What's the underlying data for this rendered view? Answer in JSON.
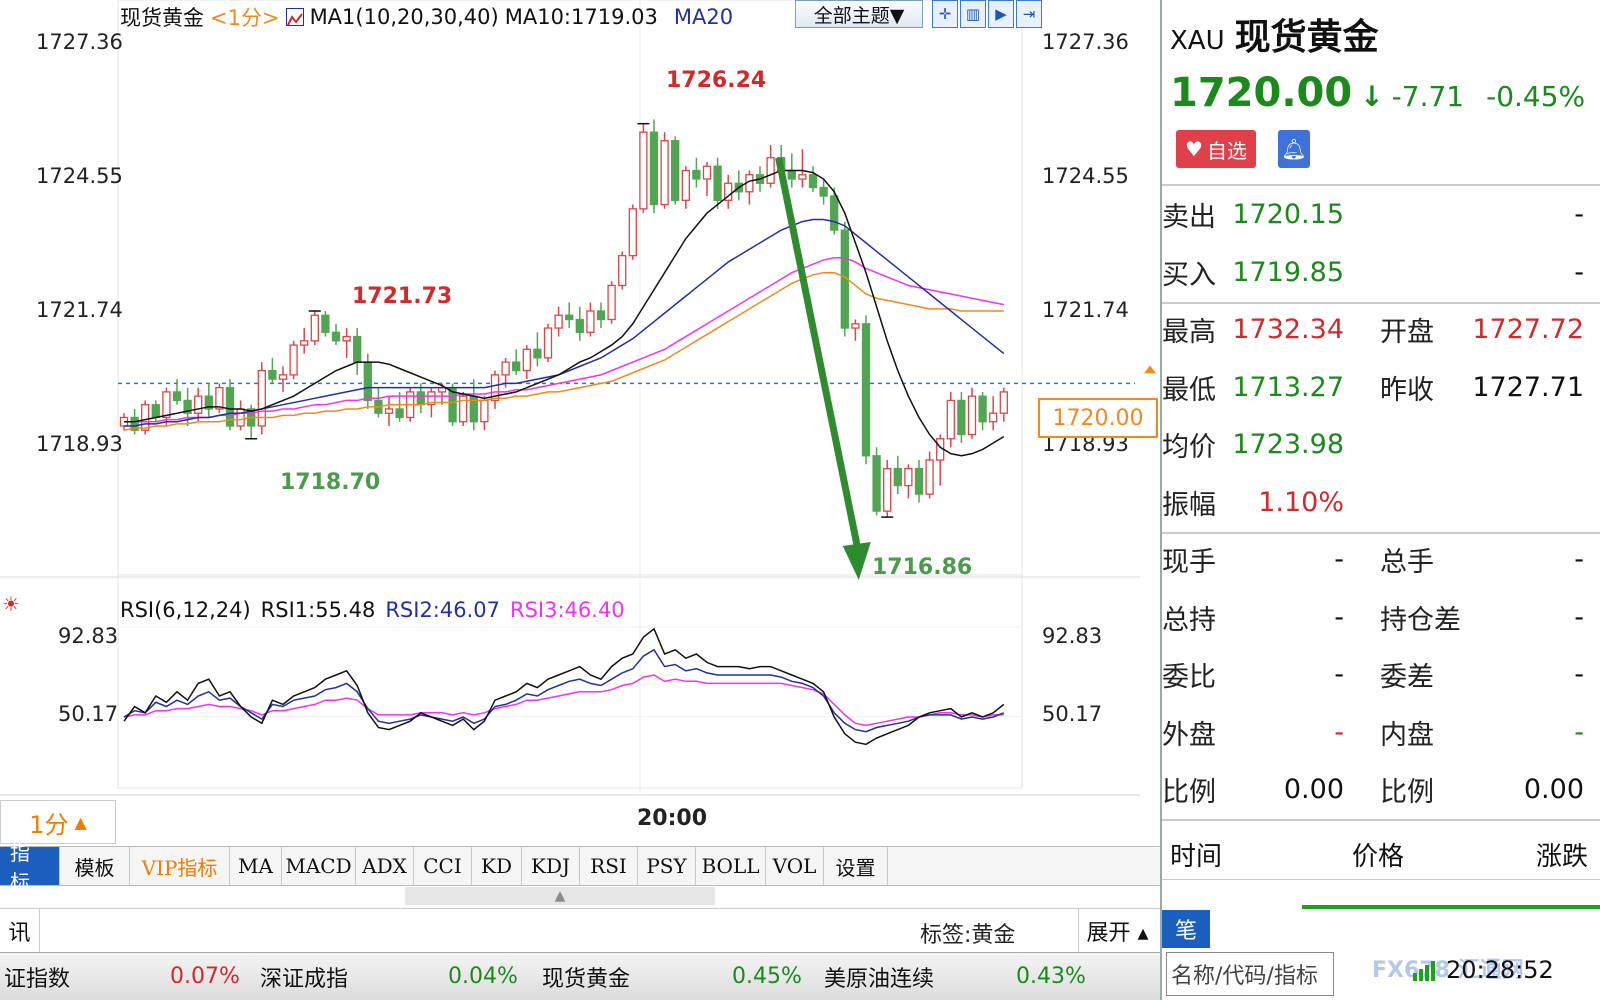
{
  "chart": {
    "symbol_label": "现货黄金",
    "period_tag": "<1分>",
    "ma_label": "MA1(10,20,30,40)",
    "ma10_label": "MA10:1719.03",
    "ma20_label": "MA20",
    "theme_button": "全部主题▼",
    "y_ticks": [
      "1727.36",
      "1724.55",
      "1721.74",
      "1718.93"
    ],
    "current_price_tag": "1720.00",
    "annotations": {
      "high1": "1726.24",
      "high2": "1721.73",
      "low1": "1718.70",
      "low2": "1716.86"
    },
    "rsi_legend": {
      "title": "RSI(6,12,24)",
      "rsi1": "RSI1:55.48",
      "rsi2": "RSI2:46.07",
      "rsi3": "RSI3:46.40"
    },
    "rsi_ticks": [
      "92.83",
      "50.17"
    ],
    "period_selector": "1分",
    "time_label": "20:00",
    "colors": {
      "up": "#d9464a",
      "down": "#52a552",
      "ma10": "#111111",
      "ma20": "#2230a0",
      "ma30": "#ee34ee",
      "ma40": "#f08a1c",
      "arrow": "#2e8b2e",
      "price_line": "#1f7ae0"
    }
  },
  "chart_data": {
    "type": "candlestick",
    "title": "现货黄金 <1分>",
    "ylim": [
      1715.5,
      1728.3
    ],
    "ohlc": [
      [
        1719.0,
        1719.3,
        1718.9,
        1719.2
      ],
      [
        1719.2,
        1719.4,
        1718.8,
        1718.9
      ],
      [
        1718.9,
        1719.6,
        1718.8,
        1719.5
      ],
      [
        1719.5,
        1719.6,
        1719.1,
        1719.2
      ],
      [
        1719.2,
        1719.9,
        1719.0,
        1719.8
      ],
      [
        1719.8,
        1720.1,
        1719.5,
        1719.6
      ],
      [
        1719.6,
        1719.9,
        1719.0,
        1719.3
      ],
      [
        1719.3,
        1719.9,
        1719.1,
        1719.7
      ],
      [
        1719.7,
        1720.0,
        1719.2,
        1719.4
      ],
      [
        1719.4,
        1720.0,
        1719.3,
        1719.9
      ],
      [
        1719.9,
        1720.1,
        1718.9,
        1719.0
      ],
      [
        1719.0,
        1719.6,
        1718.9,
        1719.4
      ],
      [
        1719.4,
        1719.5,
        1718.7,
        1719.0
      ],
      [
        1719.0,
        1720.5,
        1718.8,
        1720.3
      ],
      [
        1720.3,
        1720.6,
        1720.0,
        1720.1
      ],
      [
        1720.1,
        1720.4,
        1719.8,
        1720.2
      ],
      [
        1720.2,
        1721.0,
        1720.1,
        1720.9
      ],
      [
        1720.9,
        1721.3,
        1720.7,
        1721.0
      ],
      [
        1721.0,
        1721.7,
        1720.9,
        1721.6
      ],
      [
        1721.6,
        1721.7,
        1721.1,
        1721.2
      ],
      [
        1721.2,
        1721.4,
        1720.9,
        1721.0
      ],
      [
        1721.0,
        1721.3,
        1720.6,
        1721.1
      ],
      [
        1721.1,
        1721.3,
        1720.2,
        1720.5
      ],
      [
        1720.5,
        1720.7,
        1719.4,
        1719.6
      ],
      [
        1719.6,
        1719.9,
        1719.2,
        1719.3
      ],
      [
        1719.3,
        1719.7,
        1719.0,
        1719.4
      ],
      [
        1719.4,
        1719.8,
        1719.1,
        1719.2
      ],
      [
        1719.2,
        1719.9,
        1719.1,
        1719.8
      ],
      [
        1719.8,
        1720.0,
        1719.3,
        1719.5
      ],
      [
        1719.5,
        1719.9,
        1719.2,
        1719.8
      ],
      [
        1719.8,
        1720.0,
        1719.5,
        1719.9
      ],
      [
        1719.9,
        1720.0,
        1719.0,
        1719.1
      ],
      [
        1719.1,
        1719.8,
        1719.0,
        1719.7
      ],
      [
        1719.7,
        1720.1,
        1718.9,
        1719.1
      ],
      [
        1719.1,
        1719.7,
        1718.9,
        1719.6
      ],
      [
        1719.6,
        1720.3,
        1719.4,
        1720.2
      ],
      [
        1720.2,
        1720.6,
        1719.9,
        1720.5
      ],
      [
        1720.5,
        1720.8,
        1720.2,
        1720.3
      ],
      [
        1720.3,
        1720.9,
        1720.1,
        1720.8
      ],
      [
        1720.8,
        1721.2,
        1720.4,
        1720.6
      ],
      [
        1720.6,
        1721.4,
        1720.5,
        1721.3
      ],
      [
        1721.3,
        1721.8,
        1721.1,
        1721.6
      ],
      [
        1721.6,
        1721.9,
        1721.3,
        1721.5
      ],
      [
        1721.5,
        1721.8,
        1721.0,
        1721.2
      ],
      [
        1721.2,
        1721.9,
        1721.1,
        1721.7
      ],
      [
        1721.7,
        1721.9,
        1721.3,
        1721.5
      ],
      [
        1721.5,
        1722.4,
        1721.4,
        1722.3
      ],
      [
        1722.3,
        1723.1,
        1722.2,
        1723.0
      ],
      [
        1723.0,
        1724.2,
        1722.9,
        1724.1
      ],
      [
        1724.1,
        1726.1,
        1724.0,
        1725.9
      ],
      [
        1725.9,
        1726.2,
        1724.0,
        1724.2
      ],
      [
        1724.2,
        1725.9,
        1724.1,
        1725.7
      ],
      [
        1725.7,
        1725.8,
        1724.2,
        1724.3
      ],
      [
        1724.3,
        1725.1,
        1724.1,
        1725.0
      ],
      [
        1725.0,
        1725.3,
        1724.6,
        1724.8
      ],
      [
        1724.8,
        1725.2,
        1724.4,
        1725.1
      ],
      [
        1725.1,
        1725.3,
        1724.1,
        1724.3
      ],
      [
        1724.3,
        1724.9,
        1724.1,
        1724.7
      ],
      [
        1724.7,
        1725.0,
        1724.3,
        1724.5
      ],
      [
        1724.5,
        1725.0,
        1724.2,
        1724.9
      ],
      [
        1724.9,
        1725.1,
        1724.5,
        1724.7
      ],
      [
        1724.7,
        1725.6,
        1724.6,
        1725.3
      ],
      [
        1725.3,
        1725.6,
        1724.7,
        1725.0
      ],
      [
        1725.0,
        1725.4,
        1724.6,
        1724.8
      ],
      [
        1724.8,
        1725.5,
        1724.6,
        1724.9
      ],
      [
        1724.9,
        1725.1,
        1724.5,
        1724.6
      ],
      [
        1724.6,
        1724.8,
        1724.2,
        1724.4
      ],
      [
        1724.4,
        1724.6,
        1723.5,
        1723.6
      ],
      [
        1723.6,
        1723.8,
        1721.1,
        1721.3
      ],
      [
        1721.3,
        1721.5,
        1721.0,
        1721.4
      ],
      [
        1721.4,
        1721.6,
        1718.1,
        1718.3
      ],
      [
        1718.3,
        1718.5,
        1716.9,
        1717.0
      ],
      [
        1717.0,
        1718.2,
        1716.86,
        1718.0
      ],
      [
        1718.0,
        1718.3,
        1717.4,
        1717.6
      ],
      [
        1717.6,
        1718.1,
        1717.3,
        1718.0
      ],
      [
        1718.0,
        1718.2,
        1717.2,
        1717.4
      ],
      [
        1717.4,
        1718.4,
        1717.3,
        1718.2
      ],
      [
        1718.2,
        1718.8,
        1717.6,
        1718.7
      ],
      [
        1718.7,
        1719.8,
        1718.5,
        1719.6
      ],
      [
        1719.6,
        1719.8,
        1718.6,
        1718.8
      ],
      [
        1718.8,
        1719.9,
        1718.7,
        1719.7
      ],
      [
        1719.7,
        1719.8,
        1718.9,
        1719.1
      ],
      [
        1719.1,
        1719.7,
        1718.9,
        1719.3
      ],
      [
        1719.3,
        1719.9,
        1719.1,
        1719.8
      ]
    ],
    "ma10": [
      1719.1,
      1719.1,
      1719.15,
      1719.2,
      1719.25,
      1719.3,
      1719.35,
      1719.4,
      1719.45,
      1719.45,
      1719.4,
      1719.4,
      1719.35,
      1719.4,
      1719.5,
      1719.6,
      1719.7,
      1719.85,
      1720.0,
      1720.15,
      1720.3,
      1720.4,
      1720.5,
      1720.5,
      1720.5,
      1720.45,
      1720.35,
      1720.25,
      1720.15,
      1720.05,
      1719.95,
      1719.8,
      1719.75,
      1719.7,
      1719.65,
      1719.7,
      1719.75,
      1719.8,
      1719.9,
      1720.0,
      1720.1,
      1720.2,
      1720.35,
      1720.5,
      1720.6,
      1720.75,
      1720.9,
      1721.1,
      1721.4,
      1721.8,
      1722.2,
      1722.6,
      1723.0,
      1723.4,
      1723.7,
      1724.0,
      1724.2,
      1724.4,
      1724.6,
      1724.75,
      1724.8,
      1724.9,
      1725.0,
      1725.0,
      1725.0,
      1724.95,
      1724.8,
      1724.5,
      1724.0,
      1723.3,
      1722.6,
      1721.8,
      1721.0,
      1720.3,
      1719.7,
      1719.2,
      1718.8,
      1718.5,
      1718.35,
      1718.3,
      1718.35,
      1718.45,
      1718.6,
      1718.75
    ],
    "ma20": [
      1719.0,
      1719.0,
      1719.05,
      1719.05,
      1719.1,
      1719.1,
      1719.15,
      1719.2,
      1719.2,
      1719.25,
      1719.3,
      1719.3,
      1719.35,
      1719.4,
      1719.45,
      1719.5,
      1719.55,
      1719.6,
      1719.65,
      1719.7,
      1719.75,
      1719.8,
      1719.85,
      1719.9,
      1719.9,
      1719.9,
      1719.9,
      1719.9,
      1719.9,
      1719.9,
      1719.9,
      1719.9,
      1719.9,
      1719.9,
      1719.9,
      1719.95,
      1720.0,
      1720.0,
      1720.05,
      1720.1,
      1720.15,
      1720.2,
      1720.3,
      1720.4,
      1720.5,
      1720.6,
      1720.75,
      1720.9,
      1721.05,
      1721.25,
      1721.45,
      1721.65,
      1721.85,
      1722.05,
      1722.25,
      1722.45,
      1722.65,
      1722.85,
      1723.0,
      1723.15,
      1723.3,
      1723.45,
      1723.6,
      1723.7,
      1723.8,
      1723.85,
      1723.85,
      1723.8,
      1723.7,
      1723.5,
      1723.3,
      1723.1,
      1722.9,
      1722.7,
      1722.5,
      1722.3,
      1722.1,
      1721.9,
      1721.7,
      1721.5,
      1721.3,
      1721.1,
      1720.9,
      1720.7
    ],
    "ma30": [
      1719.1,
      1719.1,
      1719.1,
      1719.1,
      1719.15,
      1719.15,
      1719.2,
      1719.2,
      1719.2,
      1719.25,
      1719.25,
      1719.3,
      1719.3,
      1719.35,
      1719.35,
      1719.4,
      1719.4,
      1719.45,
      1719.5,
      1719.5,
      1719.55,
      1719.6,
      1719.6,
      1719.65,
      1719.65,
      1719.7,
      1719.7,
      1719.7,
      1719.7,
      1719.7,
      1719.7,
      1719.7,
      1719.75,
      1719.75,
      1719.75,
      1719.8,
      1719.8,
      1719.85,
      1719.85,
      1719.9,
      1719.95,
      1720.0,
      1720.05,
      1720.1,
      1720.15,
      1720.2,
      1720.3,
      1720.4,
      1720.5,
      1720.6,
      1720.7,
      1720.8,
      1720.95,
      1721.1,
      1721.25,
      1721.4,
      1721.55,
      1721.7,
      1721.85,
      1722.0,
      1722.15,
      1722.3,
      1722.45,
      1722.6,
      1722.7,
      1722.8,
      1722.9,
      1722.95,
      1722.95,
      1722.85,
      1722.7,
      1722.6,
      1722.5,
      1722.4,
      1722.3,
      1722.25,
      1722.2,
      1722.15,
      1722.1,
      1722.05,
      1722.0,
      1721.95,
      1721.9,
      1721.85
    ],
    "ma40": [
      1718.9,
      1718.95,
      1718.95,
      1719.0,
      1719.0,
      1719.05,
      1719.05,
      1719.1,
      1719.1,
      1719.1,
      1719.15,
      1719.15,
      1719.2,
      1719.2,
      1719.2,
      1719.25,
      1719.25,
      1719.3,
      1719.3,
      1719.35,
      1719.35,
      1719.4,
      1719.4,
      1719.45,
      1719.45,
      1719.5,
      1719.5,
      1719.5,
      1719.5,
      1719.55,
      1719.55,
      1719.55,
      1719.6,
      1719.6,
      1719.6,
      1719.65,
      1719.65,
      1719.7,
      1719.7,
      1719.75,
      1719.8,
      1719.8,
      1719.85,
      1719.9,
      1719.95,
      1720.0,
      1720.05,
      1720.15,
      1720.25,
      1720.35,
      1720.45,
      1720.55,
      1720.7,
      1720.85,
      1721.0,
      1721.15,
      1721.3,
      1721.45,
      1721.6,
      1721.75,
      1721.9,
      1722.05,
      1722.2,
      1722.35,
      1722.45,
      1722.55,
      1722.6,
      1722.6,
      1722.5,
      1722.3,
      1722.1,
      1722.0,
      1721.95,
      1721.9,
      1721.85,
      1721.8,
      1721.75,
      1721.75,
      1721.75,
      1721.7,
      1721.7,
      1721.7,
      1721.7,
      1721.7
    ],
    "rsi_ylim": [
      20,
      100
    ],
    "rsi1": [
      48,
      55,
      52,
      60,
      57,
      62,
      58,
      66,
      68,
      60,
      62,
      55,
      50,
      47,
      58,
      56,
      60,
      62,
      64,
      68,
      70,
      72,
      65,
      52,
      45,
      44,
      46,
      48,
      52,
      50,
      48,
      46,
      49,
      44,
      48,
      58,
      60,
      62,
      66,
      64,
      68,
      70,
      72,
      74,
      70,
      68,
      74,
      78,
      80,
      88,
      92,
      80,
      82,
      78,
      80,
      76,
      74,
      74,
      74,
      73,
      74,
      74,
      72,
      70,
      68,
      66,
      62,
      50,
      42,
      38,
      37,
      40,
      42,
      44,
      46,
      50,
      52,
      53,
      54,
      50,
      52,
      50,
      52,
      56
    ],
    "rsi2": [
      50,
      53,
      52,
      57,
      55,
      58,
      56,
      60,
      62,
      58,
      59,
      55,
      52,
      49,
      56,
      55,
      58,
      59,
      60,
      63,
      64,
      66,
      62,
      54,
      48,
      47,
      48,
      49,
      51,
      50,
      49,
      48,
      50,
      47,
      49,
      55,
      56,
      58,
      61,
      60,
      63,
      65,
      67,
      68,
      66,
      65,
      68,
      71,
      73,
      79,
      82,
      74,
      75,
      72,
      73,
      71,
      70,
      70,
      70,
      70,
      70,
      70,
      69,
      67,
      66,
      64,
      60,
      52,
      47,
      44,
      43,
      45,
      46,
      47,
      48,
      50,
      51,
      51,
      51,
      49,
      50,
      49,
      50,
      52
    ],
    "rsi3": [
      50,
      51,
      51,
      53,
      53,
      54,
      54,
      55,
      56,
      55,
      55,
      54,
      53,
      51,
      53,
      53,
      54,
      55,
      56,
      58,
      58,
      59,
      58,
      54,
      51,
      51,
      51,
      51,
      52,
      52,
      52,
      51,
      52,
      51,
      52,
      54,
      55,
      56,
      58,
      58,
      59,
      60,
      61,
      62,
      62,
      62,
      63,
      65,
      66,
      69,
      70,
      67,
      68,
      67,
      67,
      66,
      66,
      66,
      66,
      66,
      66,
      66,
      66,
      65,
      64,
      63,
      61,
      56,
      51,
      47,
      46,
      47,
      48,
      49,
      50,
      50,
      51,
      52,
      52,
      51,
      51,
      50,
      51,
      51
    ]
  },
  "tabs": [
    "指标",
    "模板",
    "VIP指标",
    "MA",
    "MACD",
    "ADX",
    "CCI",
    "KD",
    "KDJ",
    "RSI",
    "PSY",
    "BOLL",
    "VOL",
    "设置"
  ],
  "news": {
    "tab_label": "讯",
    "tag_text": "标签:黄金",
    "expand_label": "展开 ▴"
  },
  "ticker": [
    {
      "name": "证指数",
      "pct": "0.07%",
      "color": "#d12a2a"
    },
    {
      "name": "深证成指",
      "pct": "0.04%",
      "color": "#1a8a1a"
    },
    {
      "name": "现货黄金",
      "pct": "0.45%",
      "color": "#1a8a1a"
    },
    {
      "name": "美原油连续",
      "pct": "0.43%",
      "color": "#1a8a1a"
    }
  ],
  "quote": {
    "code": "XAU",
    "name": "现货黄金",
    "price": "1720.00",
    "arrow": "↓",
    "change": "-7.71",
    "change_pct": "-0.45%",
    "watch_label": "自选",
    "rows": [
      {
        "l1": "卖出",
        "v1": "1720.15",
        "c1": "green",
        "l2": "",
        "v2": "-",
        "c2": "blk"
      },
      {
        "l1": "买入",
        "v1": "1719.85",
        "c1": "green",
        "l2": "",
        "v2": "-",
        "c2": "blk"
      },
      {
        "l1": "最高",
        "v1": "1732.34",
        "c1": "red",
        "l2": "开盘",
        "v2": "1727.72",
        "c2": "red"
      },
      {
        "l1": "最低",
        "v1": "1713.27",
        "c1": "green",
        "l2": "昨收",
        "v2": "1727.71",
        "c2": "blk"
      },
      {
        "l1": "均价",
        "v1": "1723.98",
        "c1": "green",
        "l2": "",
        "v2": "",
        "c2": "blk"
      },
      {
        "l1": "振幅",
        "v1": "1.10%",
        "c1": "red",
        "l2": "",
        "v2": "",
        "c2": "blk"
      },
      {
        "l1": "现手",
        "v1": "-",
        "c1": "blk",
        "l2": "总手",
        "v2": "-",
        "c2": "blk"
      },
      {
        "l1": "总持",
        "v1": "-",
        "c1": "blk",
        "l2": "持仓差",
        "v2": "-",
        "c2": "blk"
      },
      {
        "l1": "委比",
        "v1": "-",
        "c1": "blk",
        "l2": "委差",
        "v2": "-",
        "c2": "blk"
      },
      {
        "l1": "外盘",
        "v1": "-",
        "c1": "red",
        "l2": "内盘",
        "v2": "-",
        "c2": "green"
      },
      {
        "l1": "比例",
        "v1": "0.00",
        "c1": "blk",
        "l2": "比例",
        "v2": "0.00",
        "c2": "blk"
      }
    ],
    "table_headers": [
      "时间",
      "价格",
      "涨跌"
    ],
    "bi_tab": "笔",
    "search_placeholder": "名称/代码/指标",
    "clock": "20:28:52",
    "logo_text": "FX678 汇通网"
  }
}
